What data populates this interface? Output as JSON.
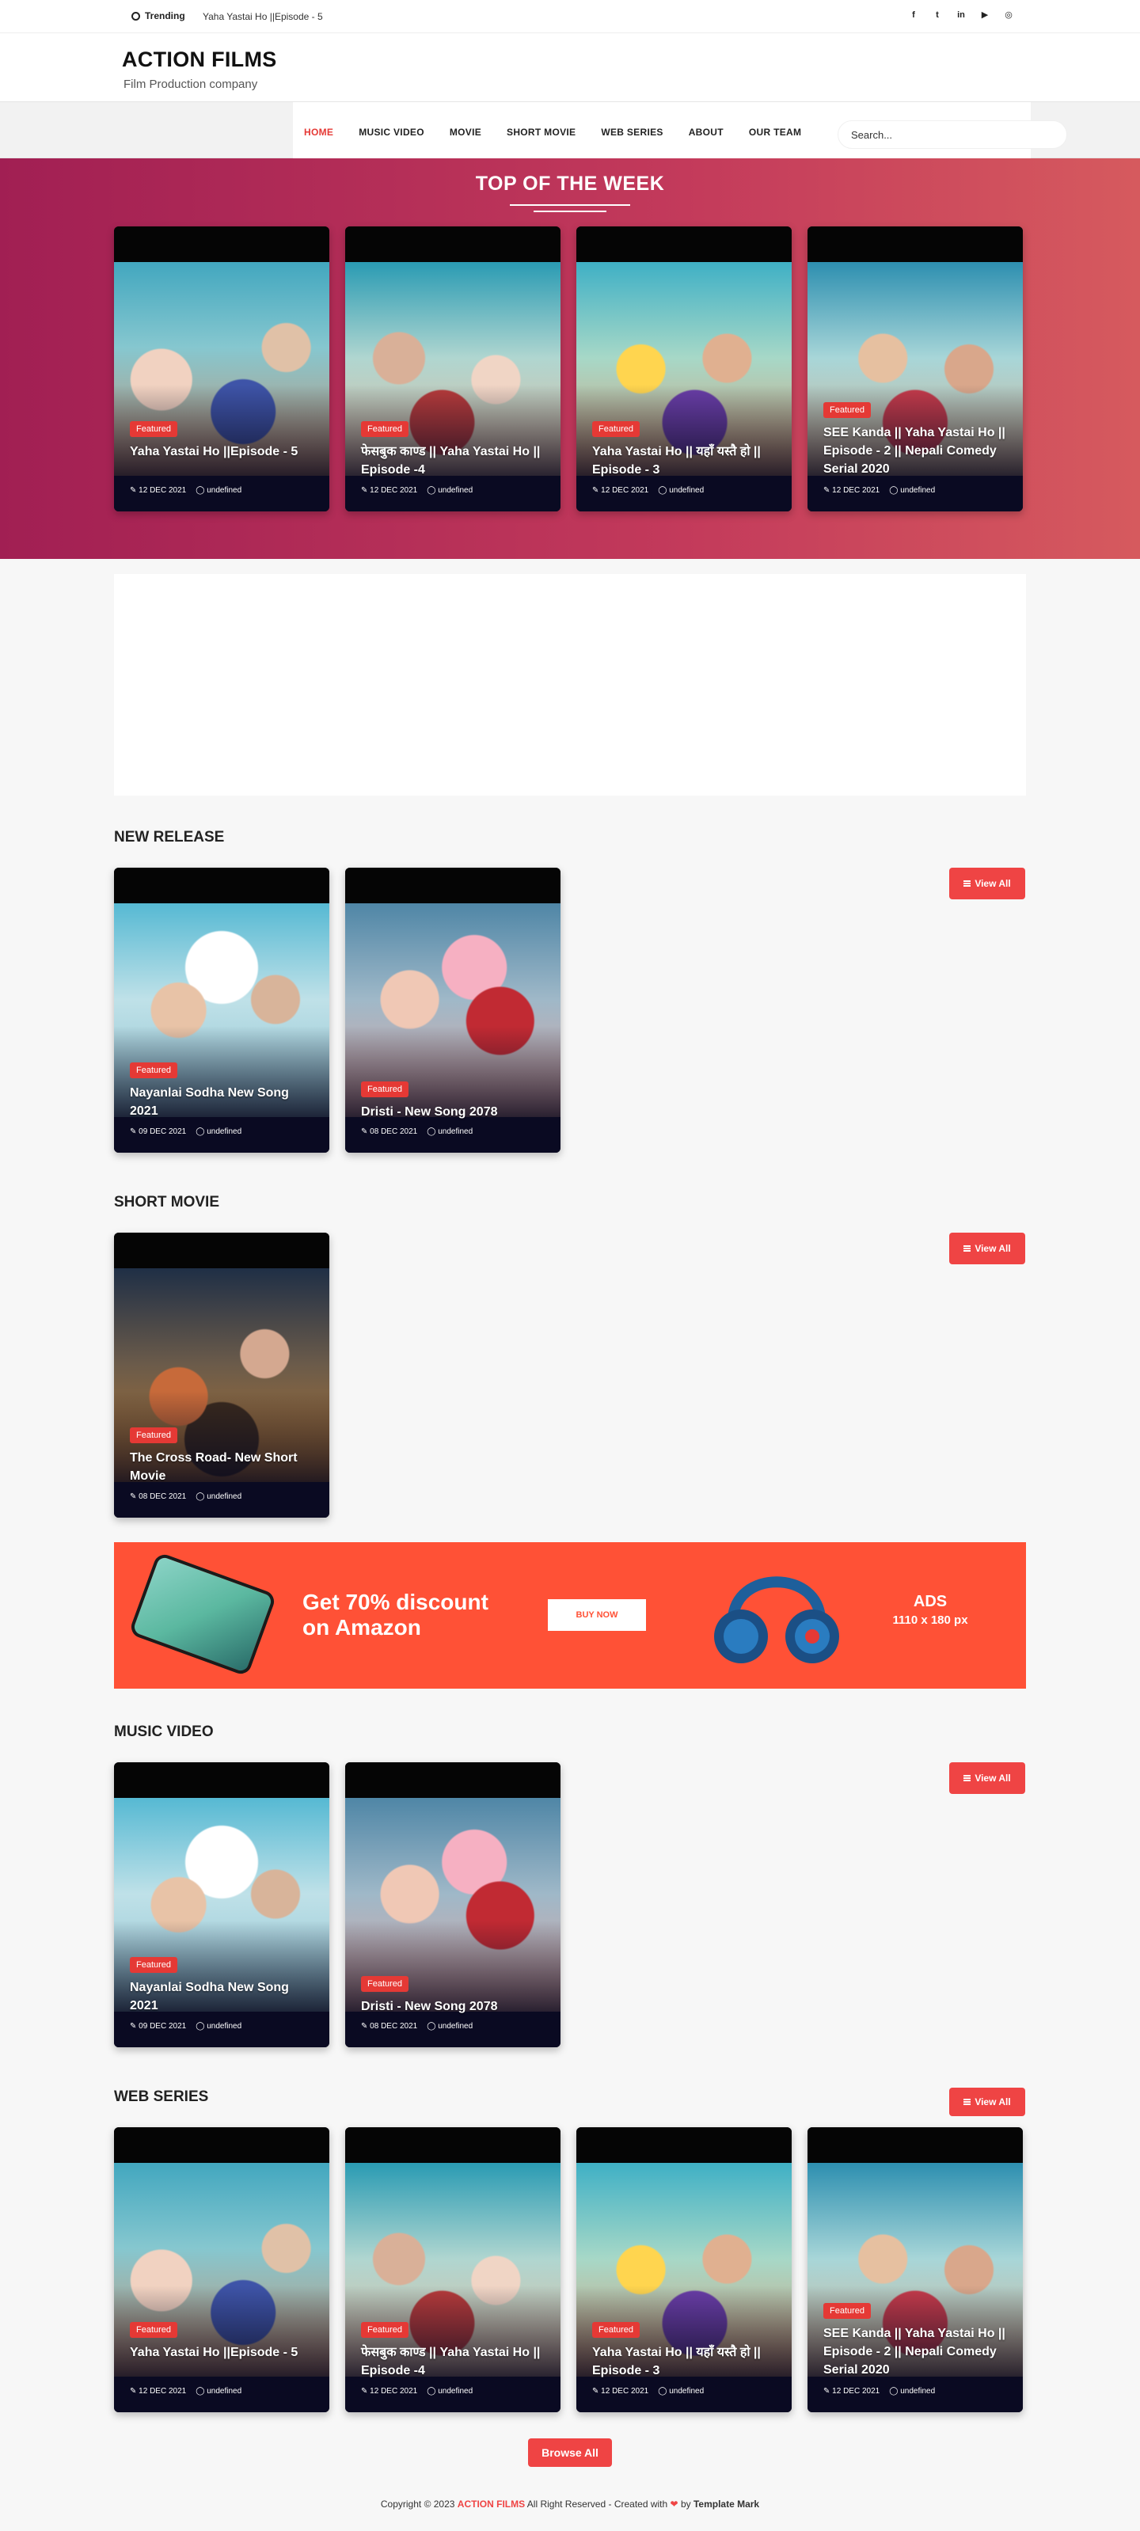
{
  "topbar": {
    "trending_label": "Trending",
    "ticker": "Yaha Yastai Ho ||Episode - 5",
    "social_icons": [
      "facebook-icon",
      "twitter-icon",
      "linkedin-icon",
      "youtube-icon",
      "instagram-icon"
    ]
  },
  "header": {
    "logo": "ACTION FILMS",
    "tagline": "Film Production company"
  },
  "nav": {
    "items": [
      "HOME",
      "MUSIC VIDEO",
      "MOVIE",
      "SHORT MOVIE",
      "WEB SERIES",
      "ABOUT",
      "OUR TEAM"
    ],
    "active": "HOME",
    "search_placeholder": "Search..."
  },
  "hero": {
    "title": "TOP OF THE WEEK",
    "background_colors": [
      "#a11f53",
      "#d65a5e"
    ]
  },
  "badge_label": "Featured",
  "meta_author": "undefined",
  "view_all_label": "View All",
  "top_week": [
    {
      "title": "Yaha Yastai Ho ||Episode - 5",
      "date": "12 DEC 2021"
    },
    {
      "title": "फेसबुक काण्ड || Yaha Yastai Ho || Episode -4",
      "date": "12 DEC 2021"
    },
    {
      "title": "Yaha Yastai Ho || यहाँ यस्तै हो || Episode - 3",
      "date": "12 DEC 2021"
    },
    {
      "title": "SEE Kanda || Yaha Yastai Ho || Episode - 2 || Nepali Comedy Serial 2020",
      "date": "12 DEC 2021"
    }
  ],
  "new_release": {
    "title": "NEW RELEASE",
    "items": [
      {
        "title": "Nayanlai Sodha New Song 2021",
        "date": "09 DEC 2021"
      },
      {
        "title": "Dristi - New Song 2078",
        "date": "08 DEC 2021"
      }
    ]
  },
  "short_movie": {
    "title": "SHORT MOVIE",
    "items": [
      {
        "title": "The Cross Road- New Short Movie",
        "date": "08 DEC 2021"
      }
    ]
  },
  "banner": {
    "headline_line1": "Get 70% discount",
    "headline_line2": "on Amazon",
    "button": "BUY NOW",
    "ads_label": "ADS",
    "ads_size": "1110 x 180 px",
    "color": "#ff5136"
  },
  "music_video": {
    "title": "MUSIC VIDEO",
    "items": [
      {
        "title": "Nayanlai Sodha New Song 2021",
        "date": "09 DEC 2021"
      },
      {
        "title": "Dristi - New Song 2078",
        "date": "08 DEC 2021"
      }
    ]
  },
  "web_series": {
    "title": "WEB SERIES",
    "items": [
      {
        "title": "Yaha Yastai Ho ||Episode - 5",
        "date": "12 DEC 2021"
      },
      {
        "title": "फेसबुक काण्ड || Yaha Yastai Ho || Episode -4",
        "date": "12 DEC 2021"
      },
      {
        "title": "Yaha Yastai Ho || यहाँ यस्तै हो || Episode - 3",
        "date": "12 DEC 2021"
      },
      {
        "title": "SEE Kanda || Yaha Yastai Ho || Episode - 2 || Nepali Comedy Serial 2020",
        "date": "12 DEC 2021"
      }
    ]
  },
  "browse_all": "Browse All",
  "footer": {
    "prefix": "Copyright © 2023",
    "brand": "ACTION FILMS",
    "middle": "All Right Reserved - Created with",
    "by": "by",
    "maker": "Template Mark"
  },
  "accent_color": "#ef4444"
}
